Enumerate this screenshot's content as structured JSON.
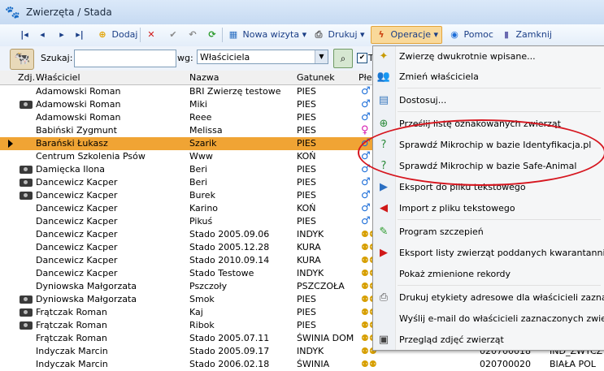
{
  "window": {
    "title": "Zwierzęta / Stada"
  },
  "toolbar": {
    "first": "|◂",
    "prev": "◂",
    "next": "▸",
    "last": "▸|",
    "add_label": "Dodaj",
    "delete": "✕",
    "confirm": "✔",
    "undo": "↶",
    "refresh": "⟳",
    "new_visit_label": "Nowa wizyta",
    "print_label": "Drukuj",
    "operations_label": "Operacje",
    "help_label": "Pomoc",
    "close_label": "Zamknij"
  },
  "search": {
    "label": "Szukaj:",
    "value": "",
    "by_label": "wg:",
    "by_value": "Właściciela",
    "t_label": "T"
  },
  "grid": {
    "columns": [
      "Zdj.",
      "Właściciel",
      "Nazwa",
      "Gatunek",
      "Płe"
    ],
    "rows": [
      {
        "photo": false,
        "owner": "Adamowski Roman",
        "name": "BRI Zwierzę testowe",
        "species": "PIES",
        "sex": "m",
        "selected": false
      },
      {
        "photo": true,
        "owner": "Adamowski Roman",
        "name": "Miki",
        "species": "PIES",
        "sex": "m",
        "selected": false
      },
      {
        "photo": false,
        "owner": "Adamowski Roman",
        "name": "Reee",
        "species": "PIES",
        "sex": "m",
        "selected": false
      },
      {
        "photo": false,
        "owner": "Babiński Zygmunt",
        "name": "Melissa",
        "species": "PIES",
        "sex": "f",
        "selected": false
      },
      {
        "photo": false,
        "owner": "Barański Łukasz",
        "name": "Szarik",
        "species": "PIES",
        "sex": "m",
        "selected": true
      },
      {
        "photo": false,
        "owner": "Centrum Szkolenia Psów",
        "name": "Www",
        "species": "KOŃ",
        "sex": "m",
        "selected": false
      },
      {
        "photo": true,
        "owner": "Damięcka Ilona",
        "name": "Beri",
        "species": "PIES",
        "sex": "m",
        "selected": false
      },
      {
        "photo": true,
        "owner": "Dancewicz Kacper",
        "name": "Beri",
        "species": "PIES",
        "sex": "m",
        "selected": false
      },
      {
        "photo": true,
        "owner": "Dancewicz Kacper",
        "name": "Burek",
        "species": "PIES",
        "sex": "m",
        "selected": false
      },
      {
        "photo": false,
        "owner": "Dancewicz Kacper",
        "name": "Karino",
        "species": "KOŃ",
        "sex": "m",
        "selected": false
      },
      {
        "photo": false,
        "owner": "Dancewicz Kacper",
        "name": "Pikuś",
        "species": "PIES",
        "sex": "m",
        "selected": false
      },
      {
        "photo": false,
        "owner": "Dancewicz Kacper",
        "name": "Stado 2005.09.06",
        "species": "INDYK",
        "sex": "grp",
        "selected": false
      },
      {
        "photo": false,
        "owner": "Dancewicz Kacper",
        "name": "Stado 2005.12.28",
        "species": "KURA",
        "sex": "grp",
        "selected": false
      },
      {
        "photo": false,
        "owner": "Dancewicz Kacper",
        "name": "Stado 2010.09.14",
        "species": "KURA",
        "sex": "grp",
        "selected": false
      },
      {
        "photo": false,
        "owner": "Dancewicz Kacper",
        "name": "Stado Testowe",
        "species": "INDYK",
        "sex": "grp",
        "selected": false
      },
      {
        "photo": false,
        "owner": "Dyniowska Małgorzata",
        "name": "Pszczoły",
        "species": "PSZCZOŁA",
        "sex": "grp",
        "selected": false
      },
      {
        "photo": true,
        "owner": "Dyniowska Małgorzata",
        "name": "Smok",
        "species": "PIES",
        "sex": "grp",
        "selected": false
      },
      {
        "photo": true,
        "owner": "Frątczak Roman",
        "name": "Kaj",
        "species": "PIES",
        "sex": "grp",
        "selected": false
      },
      {
        "photo": true,
        "owner": "Frątczak Roman",
        "name": "Ribok",
        "species": "PIES",
        "sex": "grp",
        "selected": false
      },
      {
        "photo": false,
        "owner": "Frątczak Roman",
        "name": "Stado 2005.07.11",
        "species": "ŚWINIA DOM",
        "sex": "grp",
        "selected": false
      },
      {
        "photo": false,
        "owner": "Indyczak Marcin",
        "name": "Stado 2005.09.17",
        "species": "INDYK",
        "sex": "grp",
        "selected": false
      },
      {
        "photo": false,
        "owner": "Indyczak Marcin",
        "name": "Stado 2006.02.18",
        "species": "ŚWINIA",
        "sex": "grp",
        "selected": false
      }
    ],
    "visible_right_cells": [
      {
        "a": "020700018",
        "b": "IND_ZWYCZ"
      },
      {
        "a": "020700020",
        "b": "BIAŁA POL"
      }
    ]
  },
  "operations_menu": {
    "items": [
      {
        "label": "Zwierzę dwukrotnie wpisane...",
        "icon": "✦"
      },
      {
        "label": "Zmień właściciela",
        "icon": "👥"
      },
      {
        "label": "Dostosuj...",
        "icon": "▤"
      },
      {
        "label": "Prześlij listę oznakowanych zwierząt",
        "icon": "⊕"
      },
      {
        "label": "Sprawdź Mikrochip w bazie Identyfikacja.pl",
        "icon": "?"
      },
      {
        "label": "Sprawdź Mikrochip w bazie Safe-Animal",
        "icon": "?"
      },
      {
        "label": "Eksport do pliku tekstowego",
        "icon": "▶"
      },
      {
        "label": "Import z pliku tekstowego",
        "icon": "◀"
      },
      {
        "label": "Program szczepień",
        "icon": "✎"
      },
      {
        "label": "Eksport listy zwierząt poddanych kwarantannie",
        "icon": "▶"
      },
      {
        "label": "Pokaż zmienione rekordy",
        "icon": ""
      },
      {
        "label": "Drukuj etykiety adresowe dla właścicieli zaznaczo",
        "icon": "⎙"
      },
      {
        "label": "Wyślij e-mail do właścicieli zaznaczonych zwierz",
        "icon": ""
      },
      {
        "label": "Przegląd zdjęć zwierząt",
        "icon": "▣"
      }
    ]
  },
  "colors": {
    "highlight": "#f0a434",
    "annotation": "#d6161f",
    "male": "#1e6fd9",
    "female": "#d51ab0"
  }
}
